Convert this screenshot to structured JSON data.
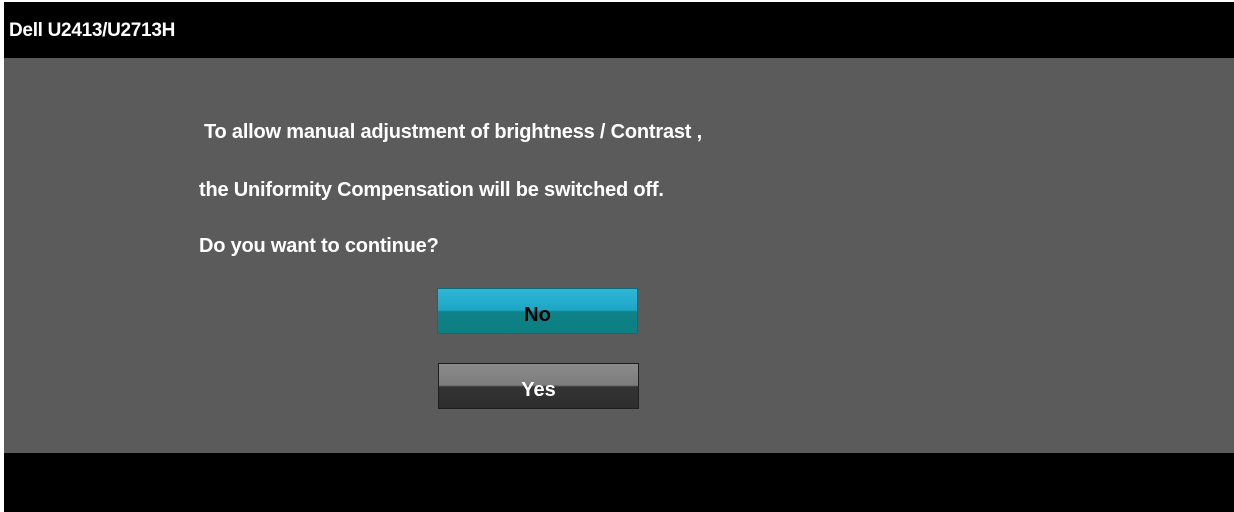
{
  "window": {
    "title": "Dell U2413/U2713H"
  },
  "dialog": {
    "message_lines": [
      "To allow manual adjustment of brightness / Contrast ,",
      "the Uniformity Compensation  will be switched off.",
      "Do you want to continue?"
    ],
    "buttons": {
      "no_label": "No",
      "yes_label": "Yes",
      "selected": "No"
    }
  },
  "colors": {
    "background": "#5b5b5b",
    "title_bar": "#000000",
    "selected_button": "#1ea6c6",
    "unselected_button": "#7d7d7d"
  }
}
